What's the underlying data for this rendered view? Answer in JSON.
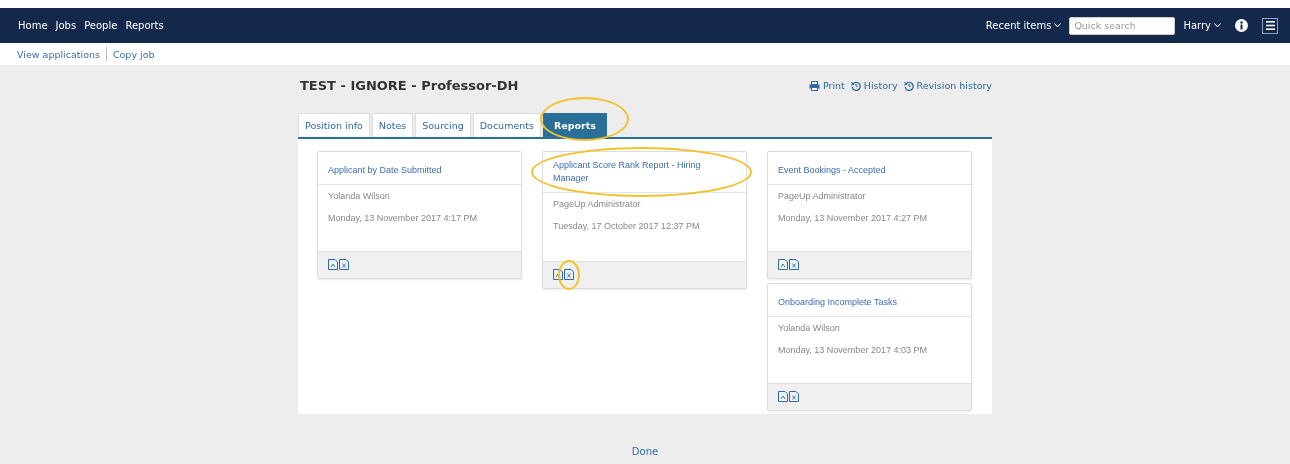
{
  "nav": {
    "items": [
      "Home",
      "Jobs",
      "People",
      "Reports"
    ],
    "recent": "Recent items",
    "search": {
      "placeholder": "Quick search"
    },
    "user": "Harry"
  },
  "subnav": [
    "View applications",
    "Copy job"
  ],
  "job": {
    "title": "TEST - IGNORE - Professor-DH",
    "actions": [
      {
        "kind": "print",
        "label": "Print"
      },
      {
        "kind": "history",
        "label": "History"
      },
      {
        "kind": "history",
        "label": "Revision history"
      }
    ]
  },
  "tabs": [
    {
      "label": "Position info",
      "selected": false,
      "highlighted": false
    },
    {
      "label": "Notes",
      "selected": false,
      "highlighted": false
    },
    {
      "label": "Sourcing",
      "selected": false,
      "highlighted": false
    },
    {
      "label": "Documents",
      "selected": false,
      "highlighted": false
    },
    {
      "label": "Reports",
      "selected": true,
      "highlighted": true
    }
  ],
  "columns": [
    {
      "reports": [
        {
          "title": "Applicant by Date Submitted",
          "highlighted": false,
          "owner": "Yolanda Wilson",
          "date": "Monday, 13 November 2017 4:17 PM",
          "icons": [
            {
              "kind": "pdf",
              "highlighted": false
            },
            {
              "kind": "excel",
              "highlighted": false
            }
          ]
        }
      ]
    },
    {
      "reports": [
        {
          "title": "Applicant Score Rank Report - Hiring Manager",
          "highlighted": true,
          "owner": "PageUp Administrator",
          "date": "Tuesday, 17 October 2017 12:37 PM",
          "icons": [
            {
              "kind": "pdf",
              "highlighted": false
            },
            {
              "kind": "excel",
              "highlighted": true
            }
          ]
        }
      ]
    },
    {
      "reports": [
        {
          "title": "Event Bookings - Accepted",
          "highlighted": false,
          "owner": "PageUp Administrator",
          "date": "Monday, 13 November 2017 4:27 PM",
          "icons": [
            {
              "kind": "pdf",
              "highlighted": false
            },
            {
              "kind": "excel",
              "highlighted": false
            }
          ]
        },
        {
          "title": "Onboarding Incomplete Tasks",
          "highlighted": false,
          "owner": "Yolanda Wilson",
          "date": "Monday, 13 November 2017 4:03 PM",
          "icons": [
            {
              "kind": "pdf",
              "highlighted": false
            },
            {
              "kind": "excel",
              "highlighted": false
            }
          ]
        }
      ]
    }
  ],
  "done": "Done"
}
